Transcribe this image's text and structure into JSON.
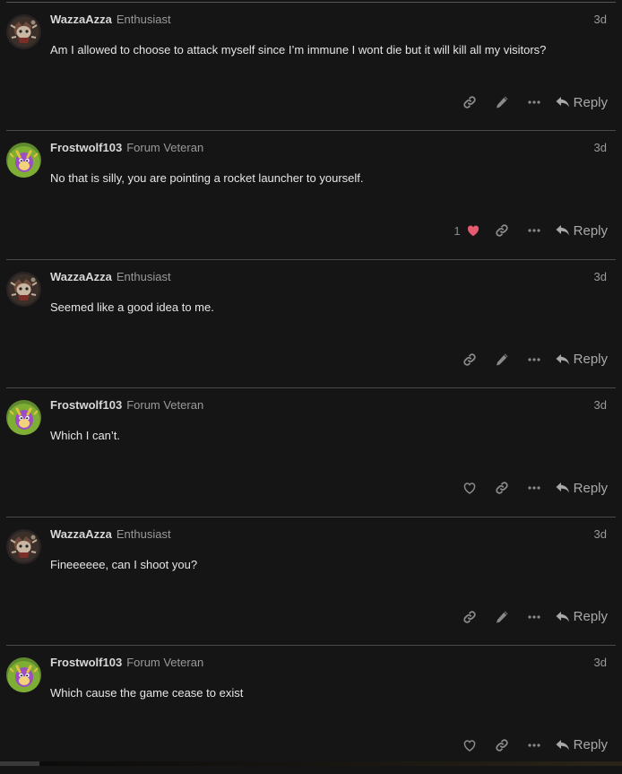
{
  "posts": [
    {
      "username": "WazzaAzza",
      "title": "Enthusiast",
      "date": "3d",
      "text": "Am I allowed to choose to attack myself since I’m immune I wont die but it will kill all my visitors?",
      "own": true,
      "reply_label": "Reply",
      "avatar": "knight-avatar"
    },
    {
      "username": "Frostwolf103",
      "title": "Forum Veteran",
      "date": "3d",
      "text": "No that is silly, you are pointing a rocket launcher to yourself.",
      "own": false,
      "like_count": "1",
      "liked": true,
      "reply_label": "Reply",
      "avatar": "dragon-avatar"
    },
    {
      "username": "WazzaAzza",
      "title": "Enthusiast",
      "date": "3d",
      "text": "Seemed like a good idea to me.",
      "own": true,
      "reply_label": "Reply",
      "avatar": "knight-avatar"
    },
    {
      "username": "Frostwolf103",
      "title": "Forum Veteran",
      "date": "3d",
      "text": "Which I can’t.",
      "own": false,
      "reply_label": "Reply",
      "avatar": "dragon-avatar"
    },
    {
      "username": "WazzaAzza",
      "title": "Enthusiast",
      "date": "3d",
      "text": "Fineeeeee, can I shoot you?",
      "own": true,
      "reply_label": "Reply",
      "avatar": "knight-avatar"
    },
    {
      "username": "Frostwolf103",
      "title": "Forum Veteran",
      "date": "3d",
      "text": "Which cause the game cease to exist",
      "own": false,
      "reply_label": "Reply",
      "avatar": "dragon-avatar"
    }
  ],
  "colors": {
    "background": "#151515",
    "like_heart": "#e45a6e",
    "muted_icon": "#8a8a8a"
  }
}
